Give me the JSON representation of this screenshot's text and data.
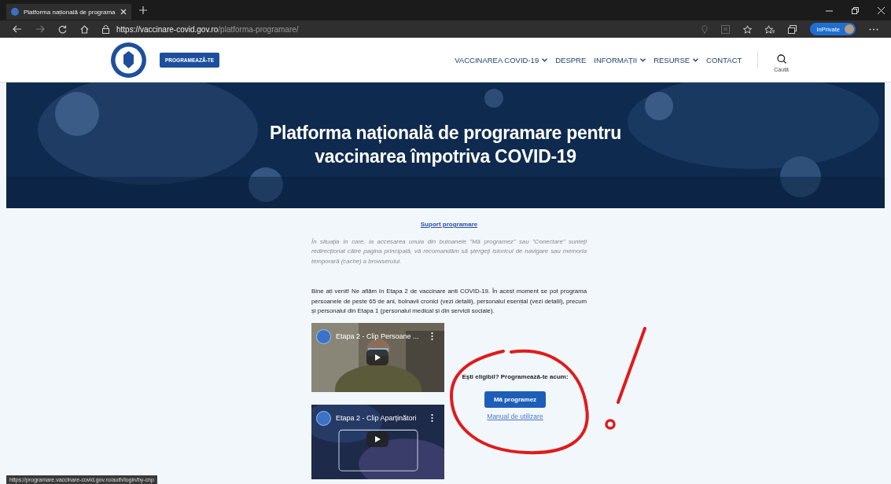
{
  "browser": {
    "tab_title": "Platforma națională de programa",
    "url_host": "https://vaccinare-covid.gov.ro",
    "url_path": "/platforma-programare/",
    "private_label": "InPrivate"
  },
  "header": {
    "cta_button": "PROGRAMEAZĂ-TE",
    "search_label": "Caută",
    "nav": [
      {
        "label": "VACCINAREA COVID-19",
        "dropdown": true
      },
      {
        "label": "DESPRE",
        "dropdown": false
      },
      {
        "label": "INFORMAȚII",
        "dropdown": true
      },
      {
        "label": "RESURSE",
        "dropdown": true
      },
      {
        "label": "CONTACT",
        "dropdown": false
      }
    ]
  },
  "hero": {
    "title": "Platforma națională de programare pentru vaccinarea împotriva COVID-19"
  },
  "content": {
    "support_link": "Suport programare",
    "notice": "În situația în care, la accesarea unuia din butoanele \"Mă programez\" sau \"Conectare\" sunteți redirecționat către pagina principală, vă recomandăm să ștergeți istoricul de navigare sau memoria temporară (cache) a browserului.",
    "intro": "Bine ați venit! Ne aflăm în Etapa 2 de vaccinare anti COVID-19. În acest moment se pot programa persoanele de peste 65 de ani, bolnavii cronici (vezi detalii), personalul esențial (vezi detalii), precum și personalul din Etapa 1 (personalul medical și din servicii sociale).",
    "videos": [
      {
        "title": "Etapa 2 - Clip Persoane ..."
      },
      {
        "title": "Etapa 2 - Clip Aparținători"
      }
    ],
    "prompt": "Ești eligibil? Programează-te acum:",
    "book_button": "Mă programez",
    "manual_link": "Manual de utilizare"
  },
  "status_url": "https://programare.vaccinare-covid.gov.ro/auth/login/by-cnp"
}
